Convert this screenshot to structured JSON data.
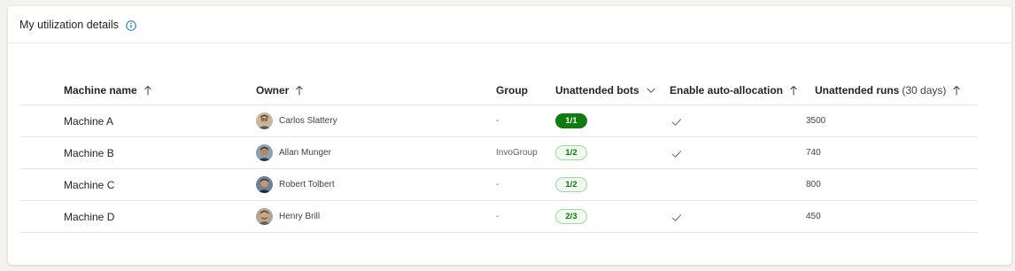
{
  "card": {
    "title": "My utilization details",
    "info_icon": "info-icon"
  },
  "table": {
    "columns": [
      {
        "label": "Machine name",
        "sort": "ascending"
      },
      {
        "label": "Owner",
        "sort": "ascending"
      },
      {
        "label": "Group",
        "sort": "none"
      },
      {
        "label": "Unattended bots",
        "sort": "dropdown"
      },
      {
        "label": "Enable auto-allocation",
        "sort": "ascending"
      },
      {
        "label": "Unattended runs",
        "sublabel": "(30 days)",
        "sort": "ascending"
      }
    ],
    "rows": [
      {
        "machine": "Machine A",
        "owner": "Carlos Slattery",
        "group": "-",
        "bots": "1/1",
        "bots_status": "full",
        "auto_allocation": true,
        "runs": "3500"
      },
      {
        "machine": "Machine B",
        "owner": "Allan Munger",
        "group": "InvoGroup",
        "bots": "1/2",
        "bots_status": "partial",
        "auto_allocation": true,
        "runs": "740"
      },
      {
        "machine": "Machine C",
        "owner": "Robert Tolbert",
        "group": "-",
        "bots": "1/2",
        "bots_status": "partial",
        "auto_allocation": false,
        "runs": "800"
      },
      {
        "machine": "Machine D",
        "owner": "Henry Brill",
        "group": "-",
        "bots": "2/3",
        "bots_status": "partial",
        "auto_allocation": true,
        "runs": "450"
      }
    ]
  },
  "colors": {
    "badge_full_bg": "#107c10",
    "badge_partial_bg": "#f1faf1",
    "badge_partial_border": "#9fd89f",
    "info_blue": "#0f6cbd"
  }
}
